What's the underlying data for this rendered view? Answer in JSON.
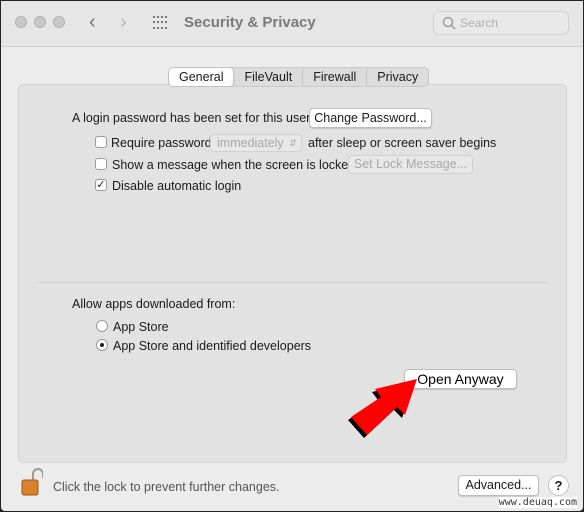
{
  "window": {
    "title": "Security & Privacy",
    "search_placeholder": "Search"
  },
  "tabs": [
    {
      "label": "General",
      "active": true
    },
    {
      "label": "FileVault"
    },
    {
      "label": "Firewall"
    },
    {
      "label": "Privacy"
    }
  ],
  "general": {
    "login_password_text": "A login password has been set for this user",
    "change_password_button": "Change Password...",
    "require_password": {
      "label": "Require password",
      "checked": false,
      "select_value": "immediately",
      "suffix": "after sleep or screen saver begins"
    },
    "show_message": {
      "label": "Show a message when the screen is locked",
      "checked": false,
      "button": "Set Lock Message..."
    },
    "disable_auto_login": {
      "label": "Disable automatic login",
      "checked": true
    },
    "allow_apps_label": "Allow apps downloaded from:",
    "radio_options": [
      {
        "label": "App Store",
        "selected": false
      },
      {
        "label": "App Store and identified developers",
        "selected": true
      }
    ],
    "open_anyway_button": "Open Anyway"
  },
  "footer": {
    "lock_text": "Click the lock to prevent further changes.",
    "advanced_button": "Advanced...",
    "help_button": "?"
  },
  "annotation": {
    "arrow_color": "#ff0000"
  },
  "watermark": "www.deuaq.com"
}
